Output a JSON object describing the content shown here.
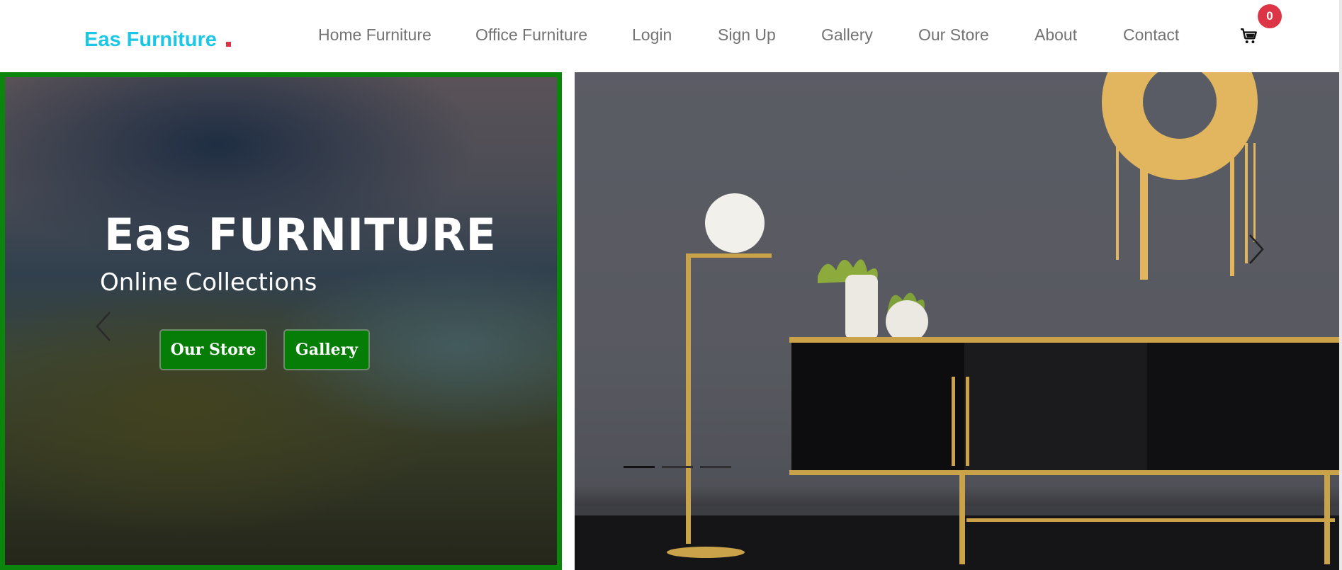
{
  "brand": {
    "name": "Eas Furniture"
  },
  "nav": {
    "items": [
      {
        "label": "Home Furniture"
      },
      {
        "label": "Office Furniture"
      },
      {
        "label": "Login"
      },
      {
        "label": "Sign Up"
      },
      {
        "label": "Gallery"
      },
      {
        "label": "Our Store"
      },
      {
        "label": "About"
      },
      {
        "label": "Contact"
      }
    ],
    "cart": {
      "icon": "cart-icon",
      "count": "0"
    }
  },
  "hero": {
    "title": "Eas FURNITURE",
    "subtitle": "Online Collections",
    "buttons": {
      "store": "Our Store",
      "gallery": "Gallery"
    },
    "controls": {
      "prev_icon": "chevron-left-icon",
      "next_icon": "chevron-right-icon"
    },
    "indicators_count": 3
  },
  "colors": {
    "brand": "#1cc7e6",
    "accent_green": "#067d06",
    "badge_red": "#dc3545",
    "nav_text": "#737373"
  }
}
